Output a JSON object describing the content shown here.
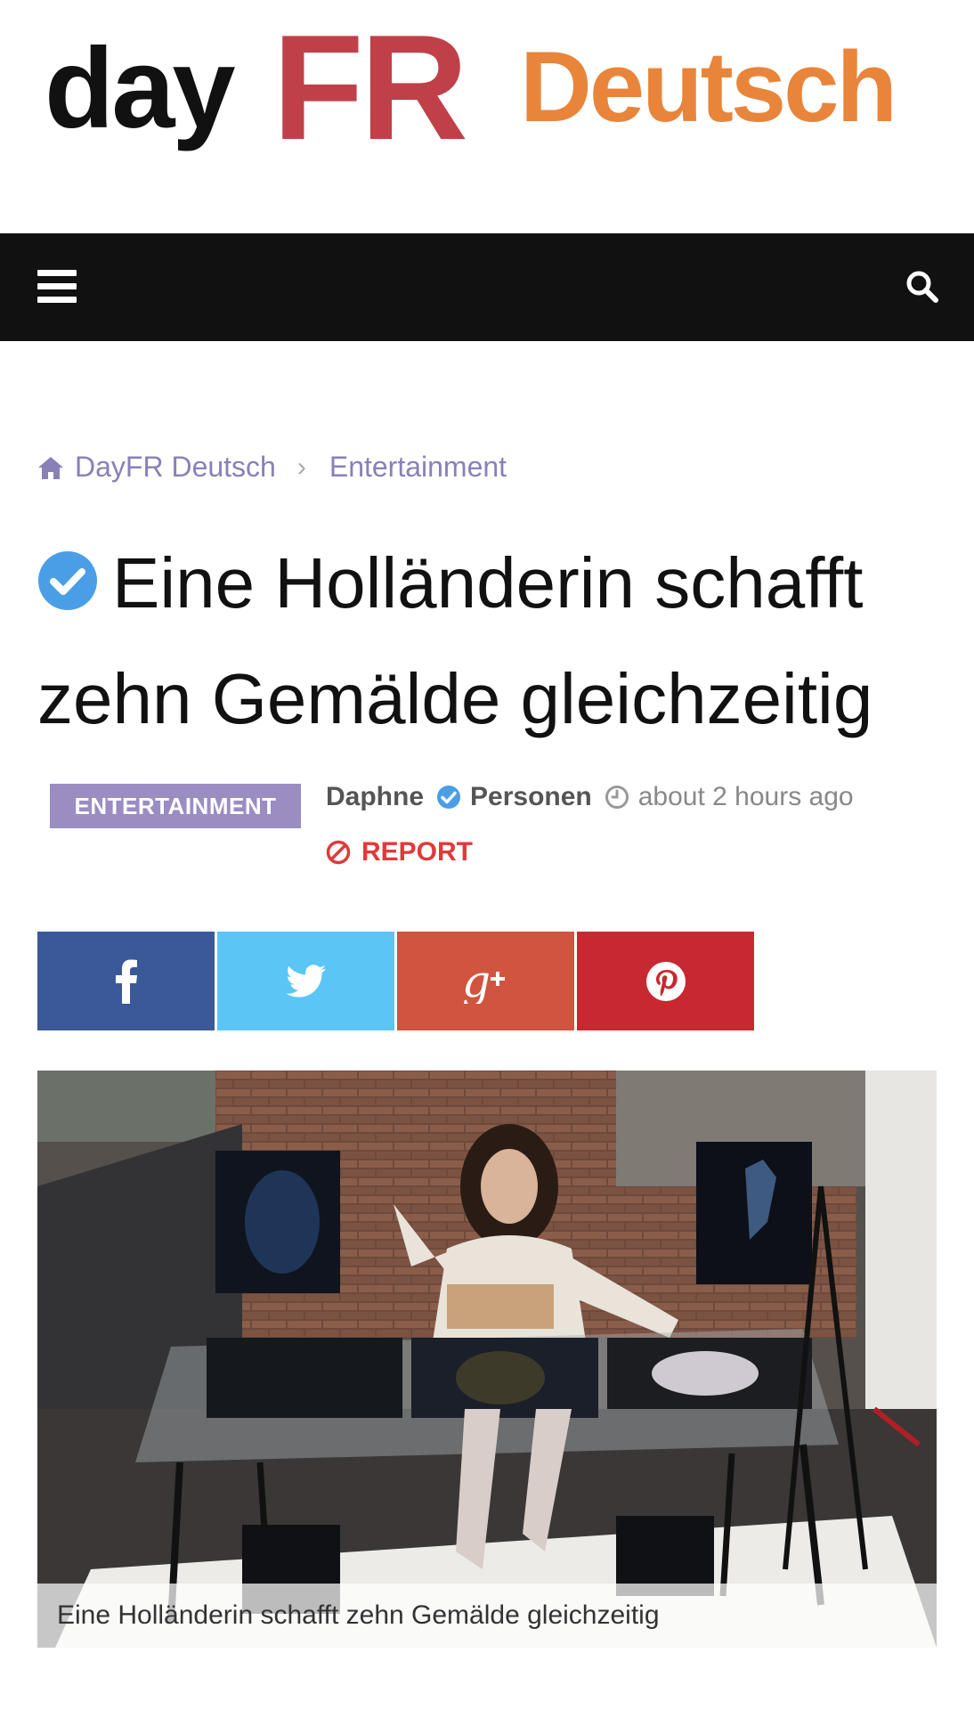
{
  "site": {
    "logo_day": "day",
    "logo_fr": "FR",
    "logo_deutsch": "Deutsch",
    "colors": {
      "fr": "#c0404a",
      "deutsch": "#e8853b",
      "nav": "#111111"
    }
  },
  "nav": {
    "menu_icon": "hamburger-icon",
    "search_icon": "search-icon"
  },
  "breadcrumb": {
    "home": "DayFR Deutsch",
    "section": "Entertainment"
  },
  "article": {
    "title": "Eine Holländerin schafft zehn Gemälde gleichzeitig",
    "category": "ENTERTAINMENT",
    "author": "Daphne",
    "group": "Personen",
    "time": "about 2 hours ago",
    "report": "REPORT",
    "caption": "Eine Holländerin schafft zehn Gemälde gleichzeitig"
  },
  "share": [
    {
      "network": "facebook",
      "color": "#3b5998"
    },
    {
      "network": "twitter",
      "color": "#5bc6f5"
    },
    {
      "network": "google-plus",
      "color": "#d1543f"
    },
    {
      "network": "pinterest",
      "color": "#c8282f"
    }
  ]
}
